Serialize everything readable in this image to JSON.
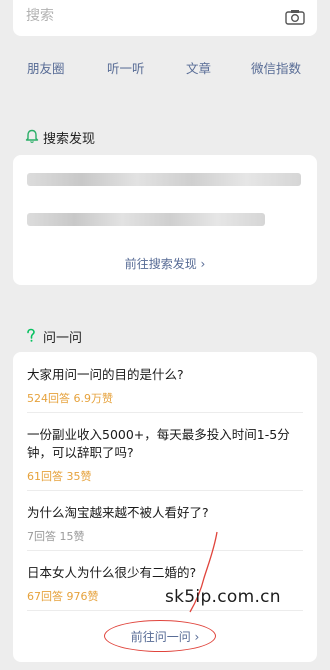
{
  "search": {
    "placeholder": "搜索",
    "camera_icon": "camera-icon"
  },
  "quick_links": [
    "朋友圈",
    "听一听",
    "文章",
    "微信指数"
  ],
  "discovery": {
    "title": "搜索发现",
    "icon": "bell-icon",
    "more_label": "前往搜索发现 ›"
  },
  "ask": {
    "title": "问一问",
    "icon": "question-icon",
    "questions": [
      {
        "title": "大家用问一问的目的是什么?",
        "meta": "524回答 6.9万赞",
        "meta_style": "orange"
      },
      {
        "title": "一份副业收入5000+，每天最多投入时间1-5分钟，可以辞职了吗?",
        "meta": "61回答 35赞",
        "meta_style": "orange"
      },
      {
        "title": "为什么淘宝越来越不被人看好了?",
        "meta": "7回答 15赞",
        "meta_style": "gray"
      },
      {
        "title": "日本女人为什么很少有二婚的?",
        "meta": "67回答 976赞",
        "meta_style": "orange"
      }
    ],
    "more_label": "前往问一问 ›"
  },
  "watermark": "sk5ip.com.cn",
  "colors": {
    "link": "#576b95",
    "accent": "#e6a23c",
    "bell": "#2aae67",
    "question": "#07c160",
    "annotation": "#e0443c"
  }
}
